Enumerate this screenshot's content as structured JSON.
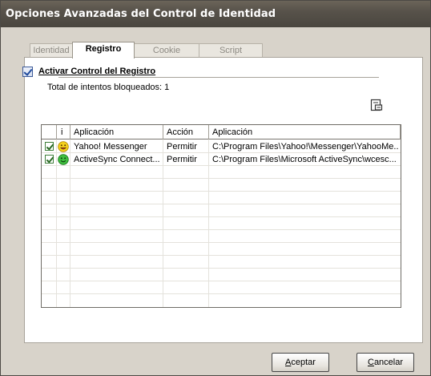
{
  "window": {
    "title": "Opciones Avanzadas del Control de Identidad"
  },
  "tabs": [
    {
      "label": "Identidad",
      "active": false
    },
    {
      "label": "Registro",
      "active": true
    },
    {
      "label": "Cookie",
      "active": false
    },
    {
      "label": "Script",
      "active": false
    }
  ],
  "registry": {
    "enable_label": "Activar Control del Registro",
    "enable_checked": true,
    "blocked_total": "Total de intentos bloqueados: 1"
  },
  "table": {
    "columns": [
      "",
      "i",
      "Aplicación",
      "Acción",
      "Aplicación"
    ],
    "rows": [
      {
        "checked": true,
        "icon": "yellow-smiley-icon",
        "app": "Yahoo! Messenger",
        "action": "Permitir",
        "path": "C:\\Program Files\\Yahoo!\\Messenger\\YahooMe..."
      },
      {
        "checked": true,
        "icon": "green-smiley-icon",
        "app": "ActiveSync Connect...",
        "action": "Permitir",
        "path": "C:\\Program Files\\Microsoft ActiveSync\\wcesc..."
      }
    ]
  },
  "buttons": {
    "accept_first": "A",
    "accept_rest": "ceptar",
    "cancel_first": "C",
    "cancel_rest": "ancelar"
  },
  "colors": {
    "titlebar": "#57524a",
    "window_bg": "#d8d3ca",
    "check_blue": "#1f4a9c",
    "check_green": "#2b6a26"
  }
}
